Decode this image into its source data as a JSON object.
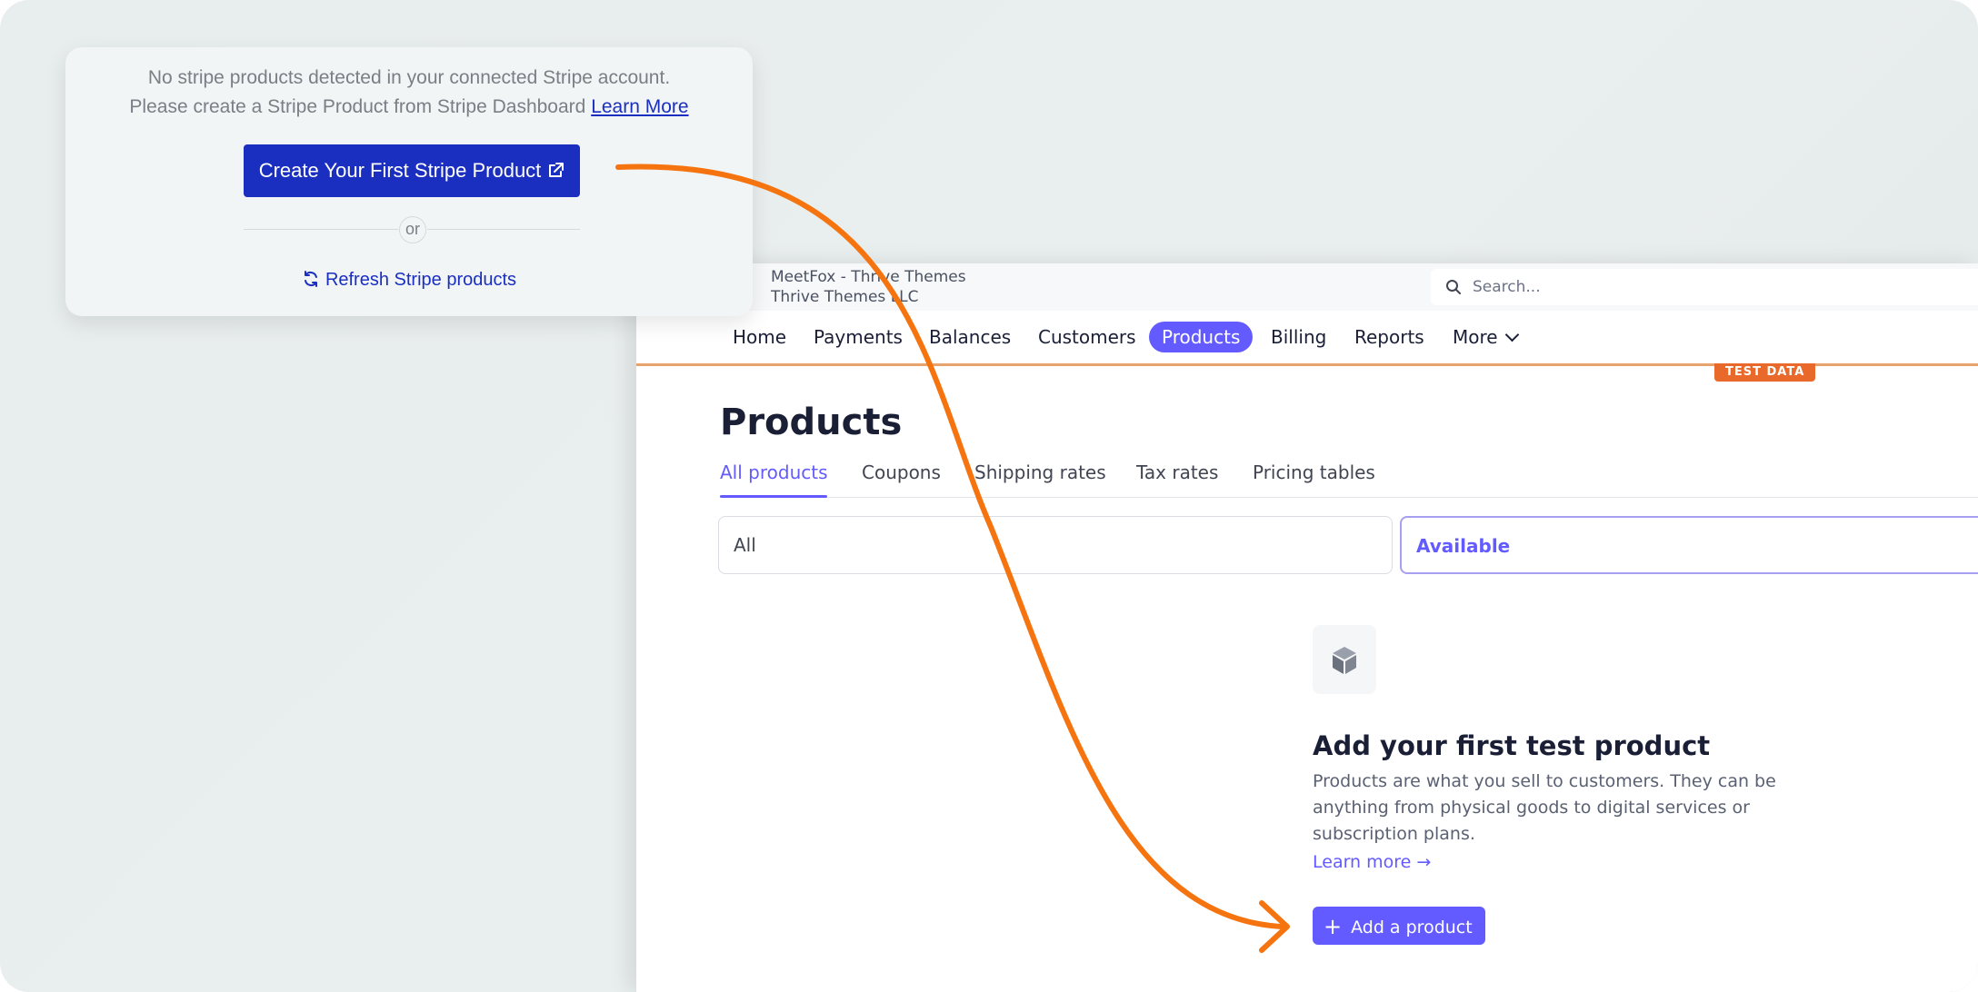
{
  "card": {
    "message_line1": "No stripe products detected in your connected Stripe account.",
    "message_line2": "Please create a Stripe Product from Stripe Dashboard",
    "learn_more": "Learn More",
    "create_button": "Create Your First Stripe Product",
    "or_label": "or",
    "refresh_label": "Refresh Stripe products"
  },
  "stripe": {
    "account_line1": "MeetFox - Thrive Themes",
    "account_line2": "Thrive Themes LLC",
    "search_placeholder": "Search...",
    "nav": [
      "Home",
      "Payments",
      "Balances",
      "Customers",
      "Products",
      "Billing",
      "Reports",
      "More"
    ],
    "nav_active": "Products",
    "test_badge": "TEST DATA",
    "page_title": "Products",
    "tabs": [
      "All products",
      "Coupons",
      "Shipping rates",
      "Tax rates",
      "Pricing tables"
    ],
    "tab_active": "All products",
    "filters": {
      "all": "All",
      "available": "Available"
    },
    "empty_title": "Add your first test product",
    "empty_description": "Products are what you sell to customers. They can be anything from physical goods to digital services or subscription plans.",
    "learn_more": "Learn more →",
    "add_button": "Add a product"
  },
  "colors": {
    "card_primary": "#1a2fc0",
    "stripe_accent": "#635bff",
    "arrow": "#f57410",
    "test_data": "#e8692a"
  },
  "icons": [
    "external-link-icon",
    "refresh-icon",
    "search-icon",
    "chevron-down-icon",
    "package-icon",
    "plus-icon",
    "arrow-annotation"
  ]
}
